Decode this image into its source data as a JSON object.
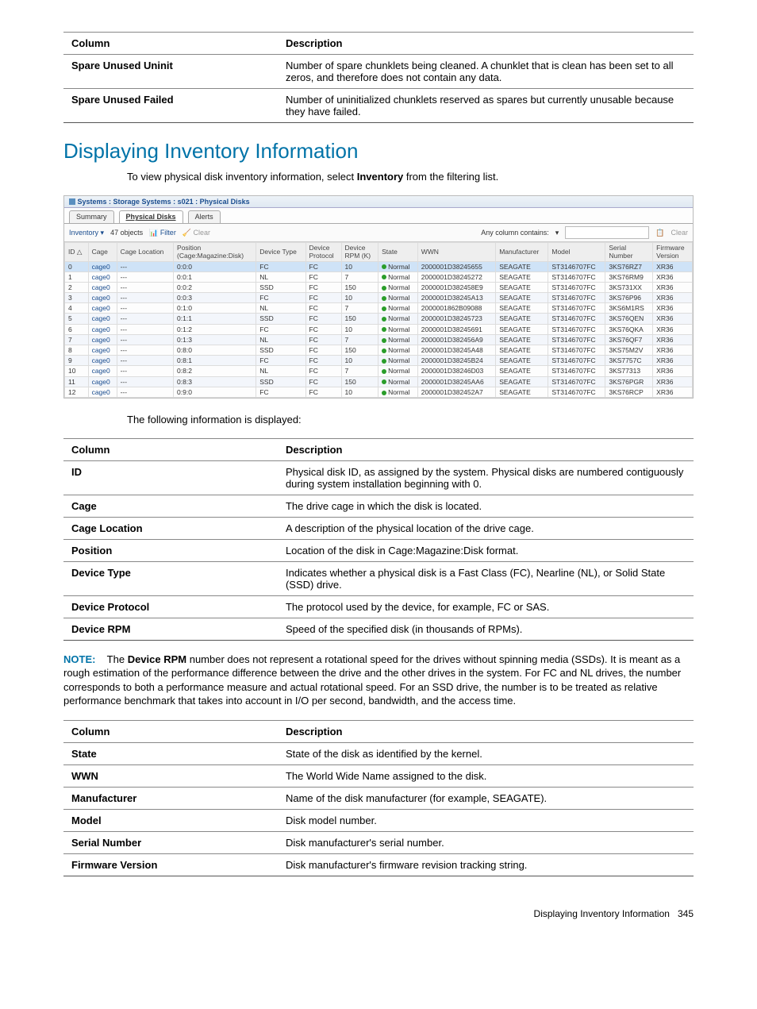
{
  "table_top": {
    "headers": [
      "Column",
      "Description"
    ],
    "rows": [
      [
        "Spare Unused Uninit",
        "Number of spare chunklets being cleaned. A chunklet that is clean has been set to all zeros, and therefore does not contain any data."
      ],
      [
        "Spare Unused Failed",
        "Number of uninitialized chunklets reserved as spares but currently unusable because they have failed."
      ]
    ]
  },
  "heading": "Displaying Inventory Information",
  "intro_a": "To view physical disk inventory information, select ",
  "intro_b": "Inventory",
  "intro_c": " from the filtering list.",
  "app": {
    "title": "Systems : Storage Systems : s021 : Physical Disks",
    "tabs": [
      "Summary",
      "Physical Disks",
      "Alerts"
    ],
    "toolbar": {
      "view": "Inventory",
      "objects": "47 objects",
      "filter": "Filter",
      "clear": "Clear",
      "any_col": "Any column contains:",
      "clear2": "Clear"
    },
    "columns": [
      "ID",
      "Cage",
      "Cage Location",
      "Position (Cage:Magazine:Disk)",
      "Device Type",
      "Device Protocol",
      "Device RPM (K)",
      "State",
      "WWN",
      "Manufacturer",
      "Model",
      "Serial Number",
      "Firmware Version"
    ],
    "rows": [
      {
        "id": 0,
        "cage": "cage0",
        "loc": "---",
        "pos": "0:0:0",
        "dtype": "FC",
        "proto": "FC",
        "rpm": 10,
        "state": "Normal",
        "wwn": "2000001D38245655",
        "mfg": "SEAGATE",
        "model": "ST3146707FC",
        "serial": "3KS76RZ7",
        "fw": "XR36",
        "sel": true
      },
      {
        "id": 1,
        "cage": "cage0",
        "loc": "---",
        "pos": "0:0:1",
        "dtype": "NL",
        "proto": "FC",
        "rpm": 7,
        "state": "Normal",
        "wwn": "2000001D38245272",
        "mfg": "SEAGATE",
        "model": "ST3146707FC",
        "serial": "3KS76RM9",
        "fw": "XR36"
      },
      {
        "id": 2,
        "cage": "cage0",
        "loc": "---",
        "pos": "0:0:2",
        "dtype": "SSD",
        "proto": "FC",
        "rpm": 150,
        "state": "Normal",
        "wwn": "2000001D382458E9",
        "mfg": "SEAGATE",
        "model": "ST3146707FC",
        "serial": "3KS731XX",
        "fw": "XR36"
      },
      {
        "id": 3,
        "cage": "cage0",
        "loc": "---",
        "pos": "0:0:3",
        "dtype": "FC",
        "proto": "FC",
        "rpm": 10,
        "state": "Normal",
        "wwn": "2000001D38245A13",
        "mfg": "SEAGATE",
        "model": "ST3146707FC",
        "serial": "3KS76P96",
        "fw": "XR36",
        "alt": true
      },
      {
        "id": 4,
        "cage": "cage0",
        "loc": "---",
        "pos": "0:1:0",
        "dtype": "NL",
        "proto": "FC",
        "rpm": 7,
        "state": "Normal",
        "wwn": "2000001862B09088",
        "mfg": "SEAGATE",
        "model": "ST3146707FC",
        "serial": "3KS6M1RS",
        "fw": "XR36"
      },
      {
        "id": 5,
        "cage": "cage0",
        "loc": "---",
        "pos": "0:1:1",
        "dtype": "SSD",
        "proto": "FC",
        "rpm": 150,
        "state": "Normal",
        "wwn": "2000001D38245723",
        "mfg": "SEAGATE",
        "model": "ST3146707FC",
        "serial": "3KS76QEN",
        "fw": "XR36",
        "alt": true
      },
      {
        "id": 6,
        "cage": "cage0",
        "loc": "---",
        "pos": "0:1:2",
        "dtype": "FC",
        "proto": "FC",
        "rpm": 10,
        "state": "Normal",
        "wwn": "2000001D38245691",
        "mfg": "SEAGATE",
        "model": "ST3146707FC",
        "serial": "3KS76QKA",
        "fw": "XR36"
      },
      {
        "id": 7,
        "cage": "cage0",
        "loc": "---",
        "pos": "0:1:3",
        "dtype": "NL",
        "proto": "FC",
        "rpm": 7,
        "state": "Normal",
        "wwn": "2000001D382456A9",
        "mfg": "SEAGATE",
        "model": "ST3146707FC",
        "serial": "3KS76QF7",
        "fw": "XR36",
        "alt": true
      },
      {
        "id": 8,
        "cage": "cage0",
        "loc": "---",
        "pos": "0:8:0",
        "dtype": "SSD",
        "proto": "FC",
        "rpm": 150,
        "state": "Normal",
        "wwn": "2000001D38245A48",
        "mfg": "SEAGATE",
        "model": "ST3146707FC",
        "serial": "3KS75M2V",
        "fw": "XR36"
      },
      {
        "id": 9,
        "cage": "cage0",
        "loc": "---",
        "pos": "0:8:1",
        "dtype": "FC",
        "proto": "FC",
        "rpm": 10,
        "state": "Normal",
        "wwn": "2000001D38245B24",
        "mfg": "SEAGATE",
        "model": "ST3146707FC",
        "serial": "3KS7757C",
        "fw": "XR36",
        "alt": true
      },
      {
        "id": 10,
        "cage": "cage0",
        "loc": "---",
        "pos": "0:8:2",
        "dtype": "NL",
        "proto": "FC",
        "rpm": 7,
        "state": "Normal",
        "wwn": "2000001D38246D03",
        "mfg": "SEAGATE",
        "model": "ST3146707FC",
        "serial": "3KS77313",
        "fw": "XR36"
      },
      {
        "id": 11,
        "cage": "cage0",
        "loc": "---",
        "pos": "0:8:3",
        "dtype": "SSD",
        "proto": "FC",
        "rpm": 150,
        "state": "Normal",
        "wwn": "2000001D38245AA6",
        "mfg": "SEAGATE",
        "model": "ST3146707FC",
        "serial": "3KS76PGR",
        "fw": "XR36",
        "alt": true
      },
      {
        "id": 12,
        "cage": "cage0",
        "loc": "---",
        "pos": "0:9:0",
        "dtype": "FC",
        "proto": "FC",
        "rpm": 10,
        "state": "Normal",
        "wwn": "2000001D382452A7",
        "mfg": "SEAGATE",
        "model": "ST3146707FC",
        "serial": "3KS76RCP",
        "fw": "XR36"
      }
    ]
  },
  "post_shot": "The following information is displayed:",
  "table_mid": {
    "headers": [
      "Column",
      "Description"
    ],
    "rows": [
      [
        "ID",
        "Physical disk ID, as assigned by the system. Physical disks are numbered contiguously during system installation beginning with 0."
      ],
      [
        "Cage",
        "The drive cage in which the disk is located."
      ],
      [
        "Cage Location",
        "A description of the physical location of the drive cage."
      ],
      [
        "Position",
        "Location of the disk in Cage:Magazine:Disk format."
      ],
      [
        "Device Type",
        "Indicates whether a physical disk is a Fast Class (FC), Nearline (NL), or Solid State (SSD) drive."
      ],
      [
        "Device Protocol",
        "The protocol used by the device, for example, FC or SAS."
      ],
      [
        "Device RPM",
        "Speed of the specified disk (in thousands of RPMs)."
      ]
    ]
  },
  "note": {
    "label": "NOTE:",
    "pre": "The ",
    "bold": "Device RPM",
    "text": " number does not represent a rotational speed for the drives without spinning media (SSDs). It is meant as a rough estimation of the performance difference between the drive and the other drives in the system. For FC and NL drives, the number corresponds to both a performance measure and actual rotational speed. For an SSD drive, the number is to be treated as relative performance benchmark that takes into account in I/O per second, bandwidth, and the access time."
  },
  "table_bot": {
    "headers": [
      "Column",
      "Description"
    ],
    "rows": [
      [
        "State",
        "State of the disk as identified by the kernel."
      ],
      [
        "WWN",
        "The World Wide Name assigned to the disk."
      ],
      [
        "Manufacturer",
        "Name of the disk manufacturer (for example, SEAGATE)."
      ],
      [
        "Model",
        "Disk model number."
      ],
      [
        "Serial Number",
        "Disk manufacturer's serial number."
      ],
      [
        "Firmware Version",
        "Disk manufacturer's firmware revision tracking string."
      ]
    ]
  },
  "footer": {
    "title": "Displaying Inventory Information",
    "page": "345"
  }
}
